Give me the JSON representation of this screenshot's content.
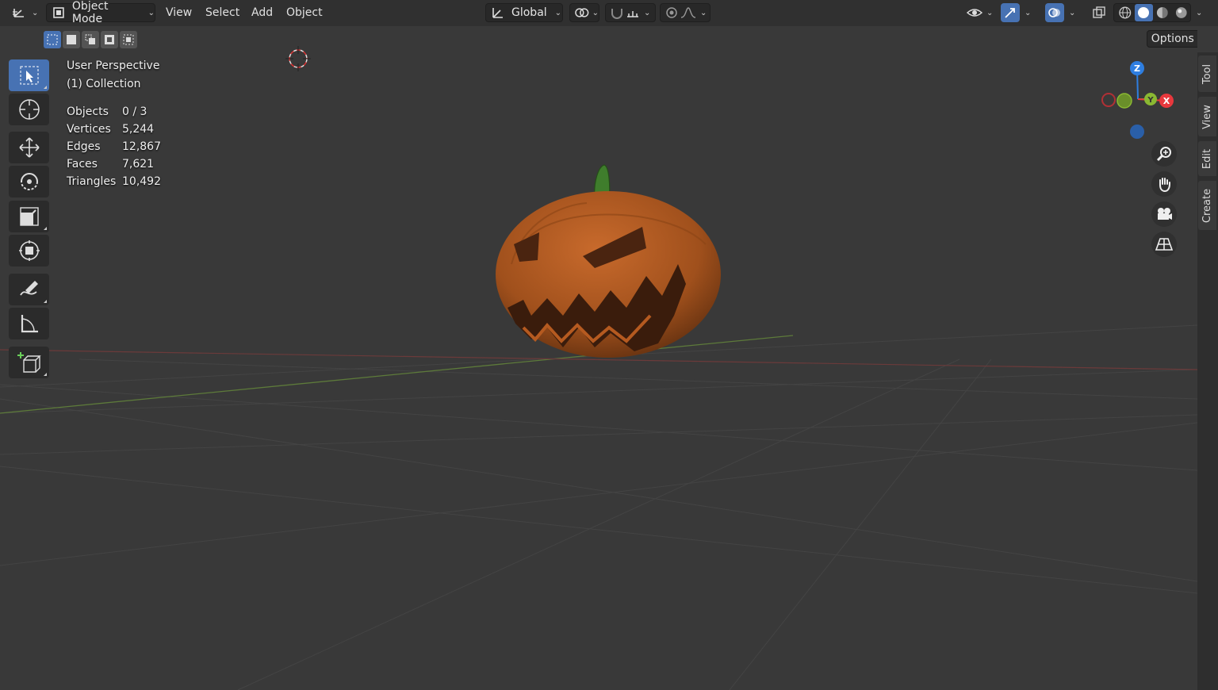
{
  "header": {
    "editor_type_icon": "axes-grid-icon",
    "mode_label": "Object Mode",
    "menus": [
      "View",
      "Select",
      "Add",
      "Object"
    ],
    "transform_orientation": "Global"
  },
  "viewport": {
    "view_name": "User Perspective",
    "collection": "(1) Collection",
    "stats": [
      {
        "label": "Objects",
        "value": "0 / 3"
      },
      {
        "label": "Vertices",
        "value": "5,244"
      },
      {
        "label": "Edges",
        "value": "12,867"
      },
      {
        "label": "Faces",
        "value": "7,621"
      },
      {
        "label": "Triangles",
        "value": "10,492"
      }
    ],
    "options_label": "Options",
    "gizmo_axes": [
      "Z",
      "Y",
      "X"
    ]
  },
  "sidebar_tabs": [
    "Tool",
    "View",
    "Edit",
    "Create"
  ],
  "tools": [
    "select-box-icon",
    "cursor-icon",
    "move-icon",
    "rotate-icon",
    "scale-icon",
    "transform-icon",
    "annotate-icon",
    "measure-icon",
    "add-cube-icon"
  ],
  "colors": {
    "accent": "#4772b3",
    "axis_x": "#e8383d",
    "axis_y": "#8ab832",
    "axis_z": "#2e7ee0",
    "pumpkin": "#b8561f",
    "stem": "#3c7a2a"
  }
}
